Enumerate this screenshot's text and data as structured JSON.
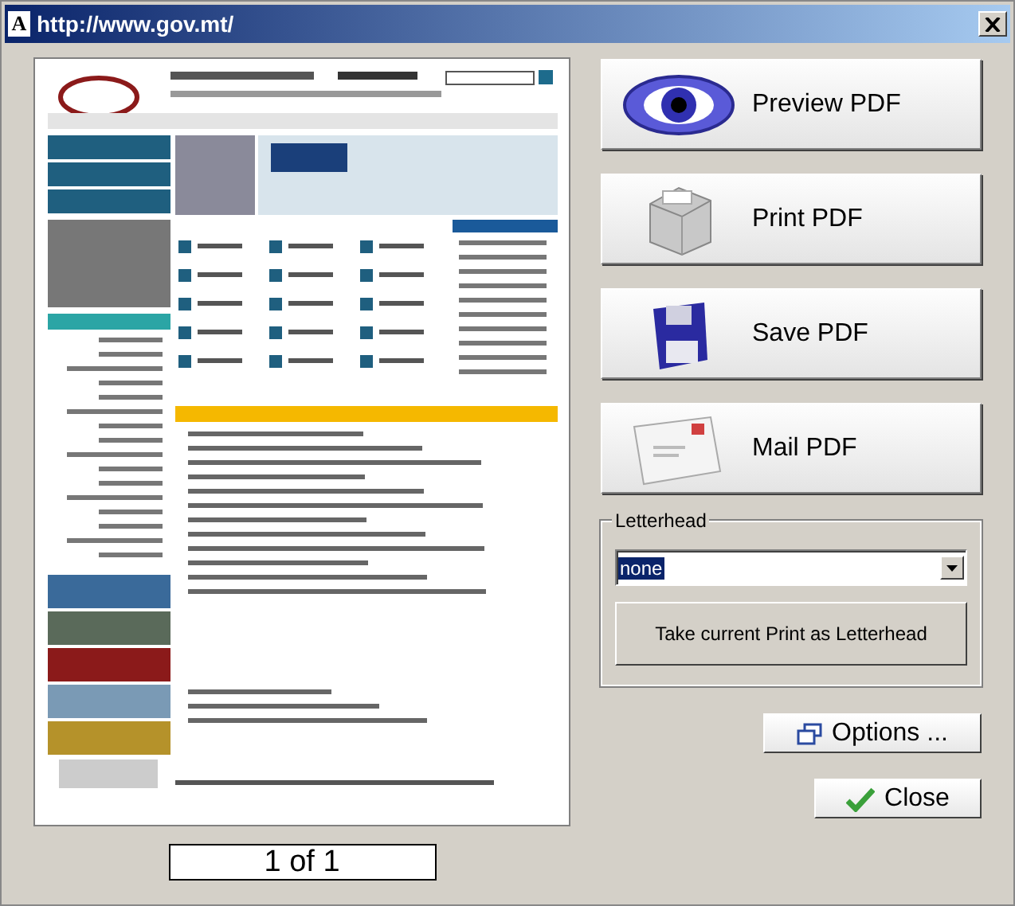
{
  "window": {
    "title": "http://www.gov.mt/",
    "app_icon": "A"
  },
  "preview": {
    "page_counter": "1 of 1"
  },
  "actions": [
    {
      "kind": "eye",
      "label": "Preview PDF"
    },
    {
      "kind": "printer",
      "label": "Print PDF"
    },
    {
      "kind": "floppy",
      "label": "Save PDF"
    },
    {
      "kind": "envelope",
      "label": "Mail PDF"
    }
  ],
  "letterhead": {
    "label": "Letterhead",
    "value": "none",
    "button": "Take current Print as Letterhead"
  },
  "buttons": [
    {
      "kind": "options",
      "label": "Options ..."
    },
    {
      "kind": "close",
      "label": "Close"
    }
  ]
}
